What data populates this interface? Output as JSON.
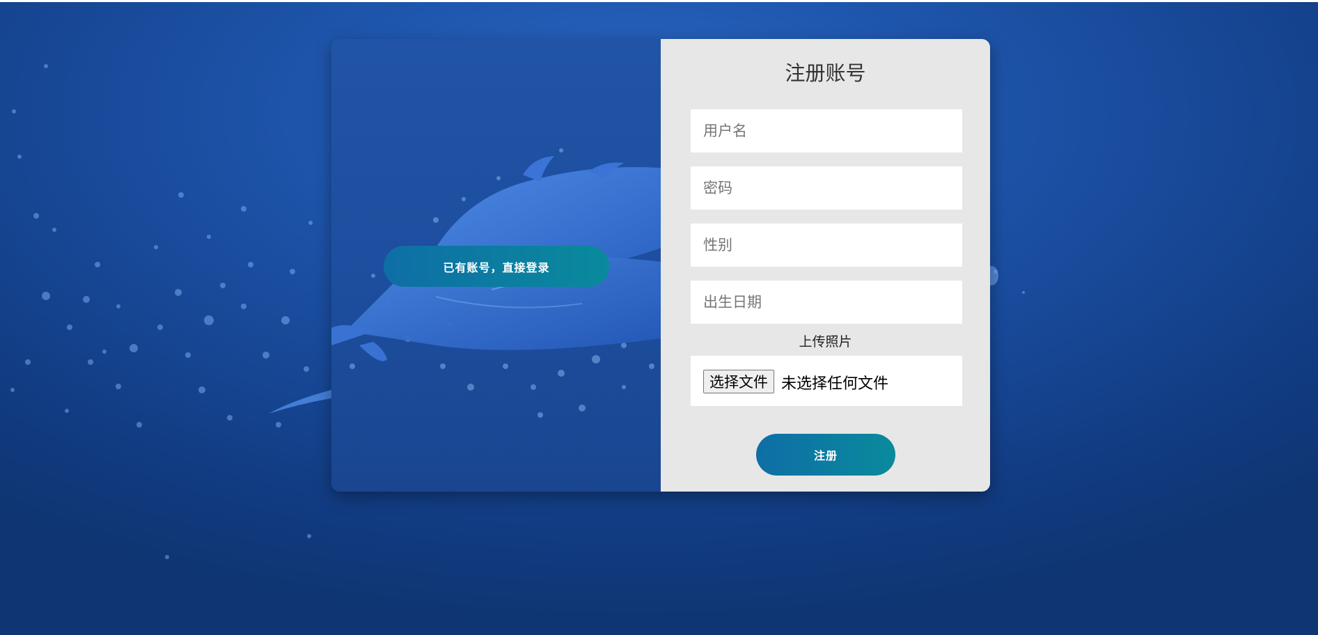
{
  "left_panel": {
    "login_button_label": "已有账号，直接登录"
  },
  "register_form": {
    "title": "注册账号",
    "username_placeholder": "用户名",
    "password_placeholder": "密码",
    "gender_placeholder": "性别",
    "birthdate_placeholder": "出生日期",
    "upload_label": "上传照片",
    "file_button_label": "选择文件",
    "file_status": "未选择任何文件",
    "submit_label": "注册"
  },
  "colors": {
    "background": "#1f56ad",
    "button_gradient_start": "#0e6ea6",
    "button_gradient_end": "#0a8a9c",
    "form_panel": "#e7e7e7"
  },
  "icons": {
    "illustration": "dolphin-illustration"
  }
}
